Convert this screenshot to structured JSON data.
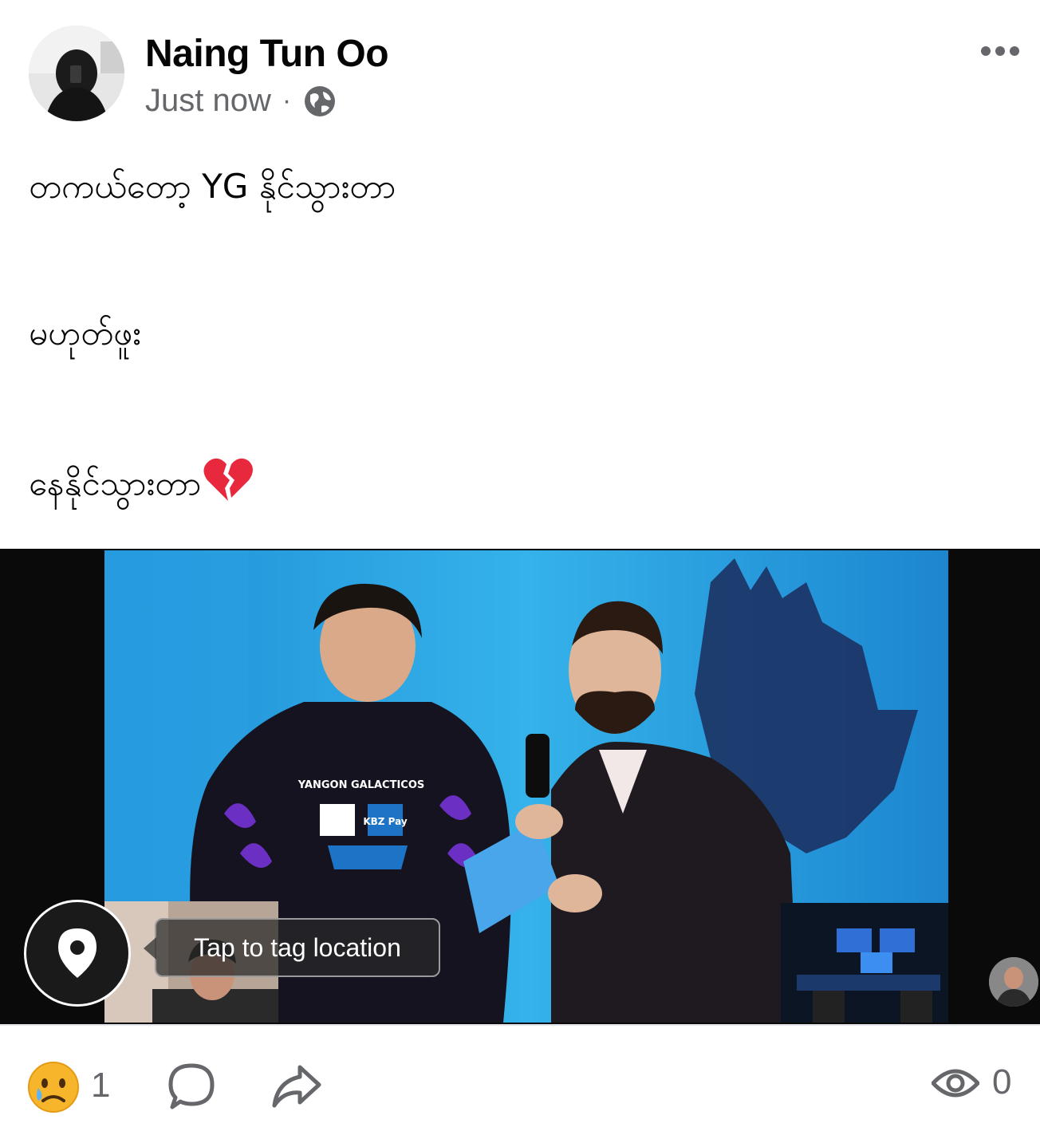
{
  "post": {
    "author": "Naing Tun Oo",
    "timestamp": "Just now",
    "separator": "·",
    "privacy_icon": "globe-icon",
    "more_icon": "more-options-icon",
    "lines": [
      "တကယ်တော့ YG နိုင်သွားတာ",
      "မဟုတ်ဖူး",
      "နေနိုင်သွားတာ"
    ],
    "line3_emoji": "broken-heart-icon"
  },
  "media": {
    "jersey_text": "YANGON GALACTICOS",
    "sponsor_text": "KBZ Pay",
    "tag_location_label": "Tap to tag location",
    "location_icon": "map-pin-icon"
  },
  "footer": {
    "reaction_icon": "sad-face-icon",
    "reaction_count": "1",
    "comment_icon": "comment-icon",
    "share_icon": "share-icon",
    "views_icon": "eye-icon",
    "views_count": "0"
  },
  "colors": {
    "text": "#050505",
    "secondary": "#65676b",
    "stage_blue": "#2aa7e0",
    "jersey_purple": "#6b2fc4",
    "broken_heart": "#e8283c"
  }
}
